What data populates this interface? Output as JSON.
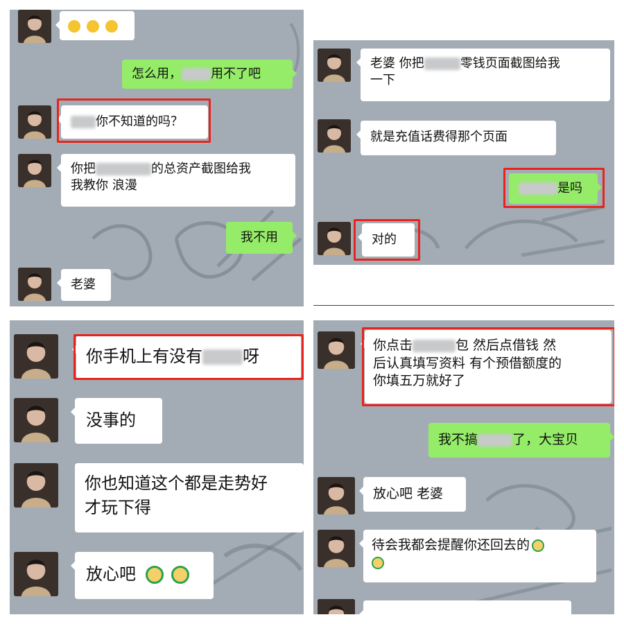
{
  "panel1": {
    "msg_how": "怎么用，",
    "msg_how_tail": "用不了吧",
    "msg_dont_know": "你不知道的吗？",
    "msg_screenshot_a": "你把",
    "msg_screenshot_b": "的总资产截图给我",
    "msg_screenshot_c": "我教你 浪漫",
    "msg_no_need": "我不用",
    "msg_wife": "老婆"
  },
  "panel2": {
    "msg_wife_screenshot_a": "老婆 你把",
    "msg_wife_screenshot_b": "零钱页面截图给我",
    "msg_wife_screenshot_c": "一下",
    "msg_recharge": "就是充值话费得那个页面",
    "msg_is_it": "是吗",
    "msg_right": "对的"
  },
  "panel3": {
    "msg_phone_a": "你手机上有没有",
    "msg_phone_b": "呀",
    "msg_no_problem": "没事的",
    "msg_trend_a": "你也知道这个都是走势好",
    "msg_trend_b": "才玩下得",
    "msg_relax": "放心吧"
  },
  "panel4": {
    "msg_click_a": "你点击",
    "msg_click_b": "包 然后点借钱 然",
    "msg_click_c": "后认真填写资料 有个预借额度的",
    "msg_click_d": "你填五万就好了",
    "msg_not_doing_a": "我不搞",
    "msg_not_doing_b": "了，大宝贝",
    "msg_relax_wife": "放心吧 老婆",
    "msg_remind": "待会我都会提醒你还回去的"
  },
  "colors": {
    "chat_bg": "#a3acb4",
    "incoming_bubble": "#ffffff",
    "outgoing_bubble": "#95ec69",
    "highlight_box": "#e8231d"
  },
  "icons": {
    "laugh_emoji": "laughing-face",
    "money_emoji": "smiling-money-bag-face"
  }
}
